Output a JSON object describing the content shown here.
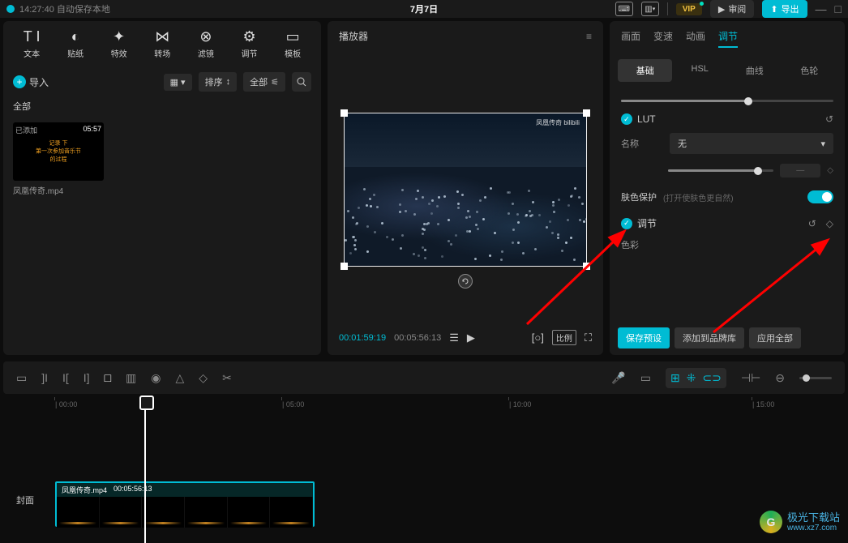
{
  "topbar": {
    "autosave": "14:27:40 自动保存本地",
    "title": "7月7日",
    "review": "审阅",
    "export": "导出",
    "vip": "VIP"
  },
  "left": {
    "tabs": [
      {
        "label": "文本",
        "icon": "T I"
      },
      {
        "label": "贴纸",
        "icon": "◐"
      },
      {
        "label": "特效",
        "icon": "✦"
      },
      {
        "label": "转场",
        "icon": "⋈"
      },
      {
        "label": "滤镜",
        "icon": "⊗"
      },
      {
        "label": "调节",
        "icon": "⚙"
      },
      {
        "label": "模板",
        "icon": "▭"
      }
    ],
    "import": "导入",
    "sort": "排序",
    "all": "全部",
    "category": "全部",
    "media": {
      "added": "已添加",
      "duration": "05:57",
      "caption1": "记录 下",
      "caption2": "第一次参加音乐节的过程",
      "name": "凤凰传奇.mp4"
    }
  },
  "player": {
    "title": "播放器",
    "watermark": "凤凰传奇 bilibili",
    "current": "00:01:59:19",
    "duration": "00:05:56:13",
    "ratio": "比例"
  },
  "right": {
    "tabs": [
      "画面",
      "变速",
      "动画",
      "调节"
    ],
    "active_tab": 3,
    "subtabs": [
      "基础",
      "HSL",
      "曲线",
      "色轮"
    ],
    "active_subtab": 0,
    "lut": {
      "title": "LUT",
      "name_label": "名称",
      "name_value": "无"
    },
    "skin": {
      "label": "肤色保护",
      "hint": "(打开使肤色更自然)"
    },
    "adjust": {
      "title": "调节",
      "color_label": "色彩"
    },
    "buttons": {
      "save": "保存预设",
      "brand": "添加到品牌库",
      "apply": "应用全部"
    }
  },
  "timeline": {
    "marks": [
      "00:00",
      "05:00",
      "10:00",
      "15:00"
    ],
    "clip": {
      "name": "凤凰传奇.mp4",
      "dur": "00:05:56:13"
    },
    "cover": "封面"
  },
  "watermark": {
    "text": "极光下载站",
    "url": "www.xz7.com"
  }
}
